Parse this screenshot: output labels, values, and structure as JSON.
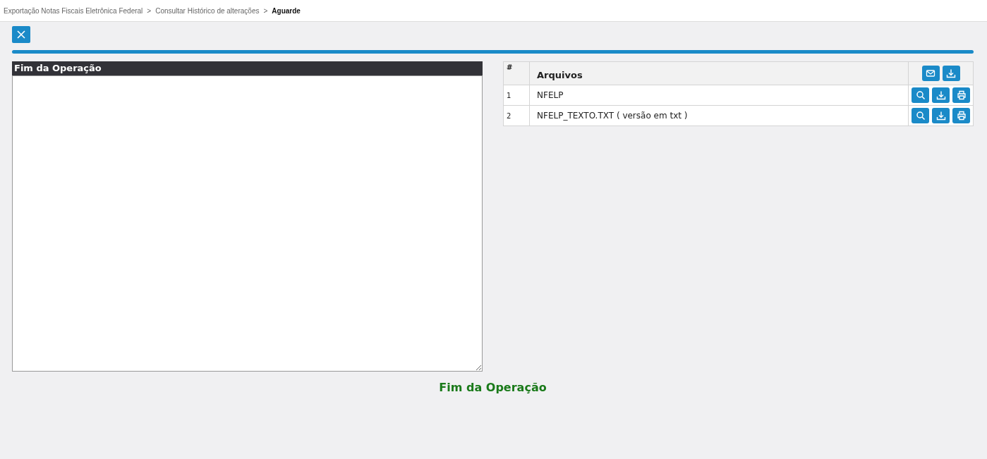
{
  "breadcrumb": [
    {
      "label": "Exportação Notas Fiscais Eletrônica Federal",
      "current": false
    },
    {
      "label": "Consultar Histórico de alterações",
      "current": false
    },
    {
      "label": "Aguarde",
      "current": true
    }
  ],
  "breadcrumb_separator": ">",
  "log_panel": {
    "title": "Fim da Operação"
  },
  "files_table": {
    "columns": [
      "#",
      "Arquivos"
    ],
    "header_actions": [
      {
        "kind": "email"
      },
      {
        "kind": "download"
      }
    ],
    "rows": [
      {
        "number": "1",
        "name": "NFELP",
        "actions": [
          {
            "kind": "view"
          },
          {
            "kind": "download"
          },
          {
            "kind": "print"
          }
        ]
      },
      {
        "number": "2",
        "name": "NFELP_TEXTO.TXT ( versão em txt )",
        "actions": [
          {
            "kind": "view"
          },
          {
            "kind": "download"
          },
          {
            "kind": "print"
          }
        ]
      }
    ]
  },
  "status_message": "Fim da Operação"
}
